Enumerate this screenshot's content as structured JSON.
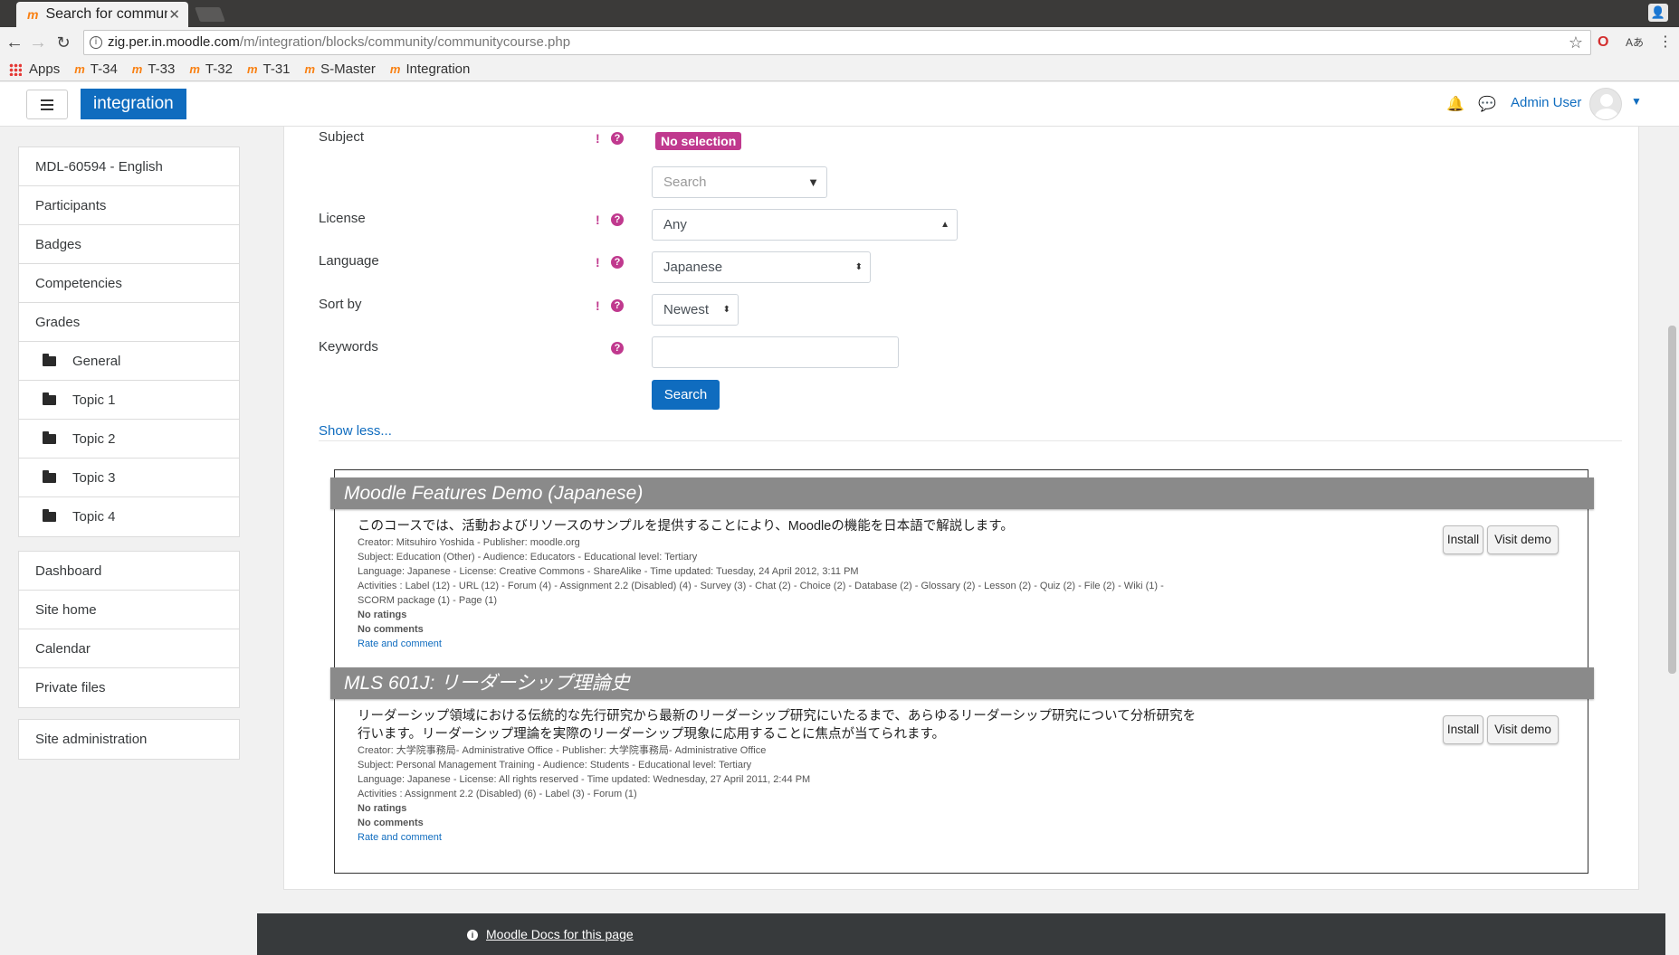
{
  "browser": {
    "tab_title": "Search for commun",
    "url_domain": "zig.per.in.moodle.com",
    "url_path": "/m/integration/blocks/community/communitycourse.php",
    "bookmarks": [
      {
        "label": "Apps"
      },
      {
        "label": "T-34"
      },
      {
        "label": "T-33"
      },
      {
        "label": "T-32"
      },
      {
        "label": "T-31"
      },
      {
        "label": "S-Master"
      },
      {
        "label": "Integration"
      }
    ]
  },
  "navbar": {
    "brand": "integration",
    "user_name": "Admin User"
  },
  "sidebar": {
    "group1": [
      {
        "label": "MDL-60594 - English"
      },
      {
        "label": "Participants"
      },
      {
        "label": "Badges"
      },
      {
        "label": "Competencies"
      },
      {
        "label": "Grades"
      },
      {
        "label": "General"
      },
      {
        "label": "Topic 1"
      },
      {
        "label": "Topic 2"
      },
      {
        "label": "Topic 3"
      },
      {
        "label": "Topic 4"
      }
    ],
    "group2": [
      {
        "label": "Dashboard"
      },
      {
        "label": "Site home"
      },
      {
        "label": "Calendar"
      },
      {
        "label": "Private files"
      }
    ],
    "group3": [
      {
        "label": "Site administration"
      }
    ]
  },
  "form": {
    "subject_label": "Subject",
    "subject_badge": "No selection",
    "subject_search_placeholder": "Search",
    "license_label": "License",
    "license_value": "Any",
    "language_label": "Language",
    "language_value": "Japanese",
    "sortby_label": "Sort by",
    "sortby_value": "Newest",
    "keywords_label": "Keywords",
    "keywords_value": "",
    "search_button": "Search",
    "show_less": "Show less..."
  },
  "courses": [
    {
      "title": "Moodle Features Demo (Japanese)",
      "description": "このコースでは、活動およびリソースのサンプルを提供することにより、Moodleの機能を日本語で解説します。",
      "creator": "Creator: Mitsuhiro Yoshida - Publisher: moodle.org",
      "subject": "Subject: Education (Other) - Audience: Educators - Educational level: Tertiary",
      "language": "Language: Japanese - License: Creative Commons - ShareAlike - Time updated: Tuesday, 24 April 2012, 3:11 PM",
      "activities": "Activities : Label (12) - URL (12) - Forum (4) - Assignment 2.2 (Disabled) (4) - Survey (3) - Chat (2) - Choice (2) - Database (2) - Glossary (2) - Lesson (2) - Quiz (2) - File (2) - Wiki (1) - SCORM package (1) - Page (1)",
      "ratings": "No ratings",
      "comments": "No comments",
      "rate_link": "Rate and comment",
      "install": "Install",
      "visit_demo": "Visit demo"
    },
    {
      "title": "MLS 601J: リーダーシップ理論史",
      "description": "リーダーシップ領域における伝統的な先行研究から最新のリーダーシップ研究にいたるまで、あらゆるリーダーシップ研究について分析研究を行います。リーダーシップ理論を実際のリーダーシップ現象に応用することに焦点が当てられます。",
      "creator": "Creator: 大学院事務局- Administrative Office - Publisher: 大学院事務局- Administrative Office",
      "subject": "Subject: Personal Management Training - Audience: Students - Educational level: Tertiary",
      "language": "Language: Japanese - License: All rights reserved - Time updated: Wednesday, 27 April 2011, 2:44 PM",
      "activities": "Activities : Assignment 2.2 (Disabled) (6) - Label (3) - Forum (1)",
      "ratings": "No ratings",
      "comments": "No comments",
      "rate_link": "Rate and comment",
      "install": "Install",
      "visit_demo": "Visit demo"
    }
  ],
  "footer": {
    "docs_link": "Moodle Docs for this page"
  },
  "colors": {
    "brand": "#0f6cbf",
    "required": "#c0398e",
    "course_header": "#8a8a8a"
  }
}
